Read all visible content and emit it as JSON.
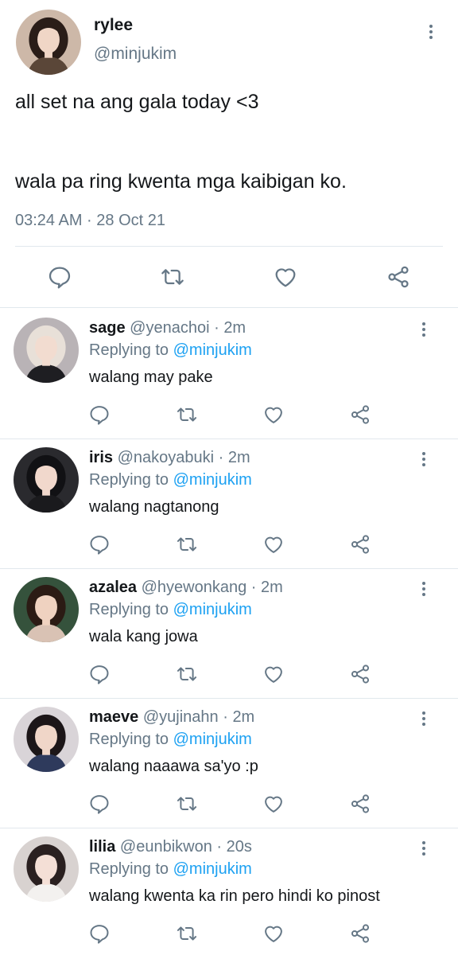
{
  "main": {
    "name": "rylee",
    "handle": "@minjukim",
    "text_line1": "all set na ang gala today <3",
    "text_line2": "wala pa ring kwenta mga kaibigan ko.",
    "meta": "03:24 AM · 28 Oct 21",
    "avatar_colors": {
      "bg": "#cdb8a8",
      "hair": "#2a1d18",
      "face": "#f0d6c6",
      "shirt": "#5a4638"
    }
  },
  "replies": [
    {
      "name": "sage",
      "handle": "@yenachoi",
      "dot": " · ",
      "time": "2m",
      "replying_prefix": "Replying to ",
      "mention": "@minjukim",
      "text": "walang may pake",
      "avatar_colors": {
        "bg": "#b9b3b6",
        "hair": "#e8e0d8",
        "face": "#f2dcd0",
        "shirt": "#1e1e22"
      }
    },
    {
      "name": "iris",
      "handle": "@nakoyabuki",
      "dot": " · ",
      "time": "2m",
      "replying_prefix": "Replying to ",
      "mention": "@minjukim",
      "text": "walang nagtanong",
      "avatar_colors": {
        "bg": "#2a2a2e",
        "hair": "#111114",
        "face": "#f1d8cc",
        "shirt": "#1a1a1d"
      }
    },
    {
      "name": "azalea",
      "handle": "@hyewonkang",
      "dot": " · ",
      "time": "2m",
      "replying_prefix": "Replying to ",
      "mention": "@minjukim",
      "text": "wala kang jowa",
      "avatar_colors": {
        "bg": "#35523c",
        "hair": "#2b1b14",
        "face": "#efd2c0",
        "shirt": "#d9c2b4"
      }
    },
    {
      "name": "maeve",
      "handle": "@yujinahn",
      "dot": " · ",
      "time": "2m",
      "replying_prefix": "Replying to ",
      "mention": "@minjukim",
      "text": "walang naaawa sa'yo :p",
      "avatar_colors": {
        "bg": "#d9d4d8",
        "hair": "#1c1618",
        "face": "#f0d6c8",
        "shirt": "#2e3a5c"
      }
    },
    {
      "name": "lilia",
      "handle": "@eunbikwon",
      "dot": " · ",
      "time": "20s",
      "replying_prefix": "Replying to ",
      "mention": "@minjukim",
      "text": "walang kwenta ka rin pero hindi ko pinost",
      "avatar_colors": {
        "bg": "#d8d2d0",
        "hair": "#2a2020",
        "face": "#f4dfd6",
        "shirt": "#f3f1ef"
      }
    }
  ],
  "icons": {
    "reply": "reply-icon",
    "retweet": "retweet-icon",
    "like": "heart-icon",
    "share": "share-icon",
    "more": "more-options-icon"
  },
  "colors": {
    "link": "#1da1f2",
    "secondary_text": "#657786",
    "icon": "#657786",
    "divider": "#e1e8ed"
  }
}
